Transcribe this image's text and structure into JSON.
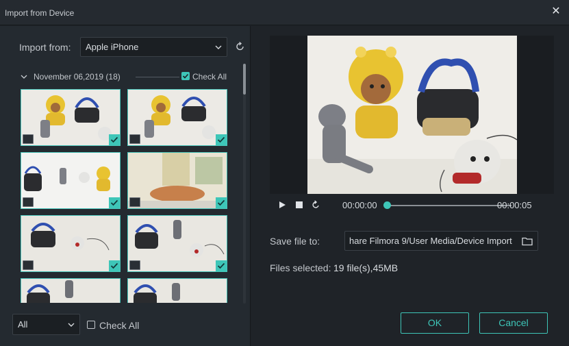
{
  "window": {
    "title": "Import from Device"
  },
  "left": {
    "import_from_label": "Import from:",
    "device": "Apple iPhone",
    "group": {
      "date": "November 06,2019 (18)",
      "check_all_label": "Check All",
      "checked": true
    },
    "thumbnails": [
      {
        "kind": "video-icon",
        "checked": true
      },
      {
        "kind": "image-icon",
        "checked": true
      },
      {
        "kind": "video-icon",
        "checked": true
      },
      {
        "kind": "image-icon",
        "checked": true
      },
      {
        "kind": "image-icon",
        "checked": true
      },
      {
        "kind": "video-icon",
        "checked": true
      },
      {
        "kind": "image-icon",
        "checked": true
      },
      {
        "kind": "video-icon",
        "checked": true
      }
    ],
    "filter": "All",
    "bottom_check_all_label": "Check All",
    "bottom_checked": false
  },
  "right": {
    "time_current": "00:00:00",
    "time_total": "00:00:05",
    "playback_progress": 0,
    "save_label": "Save file to:",
    "save_path": "hare Filmora 9/User Media/Device Import",
    "files_selected_label": "Files selected:",
    "files_selected_value": "19 file(s),45MB",
    "ok_label": "OK",
    "cancel_label": "Cancel"
  },
  "colors": {
    "accent": "#3ec6b8",
    "panel": "#242a30",
    "background": "#1f2328"
  }
}
